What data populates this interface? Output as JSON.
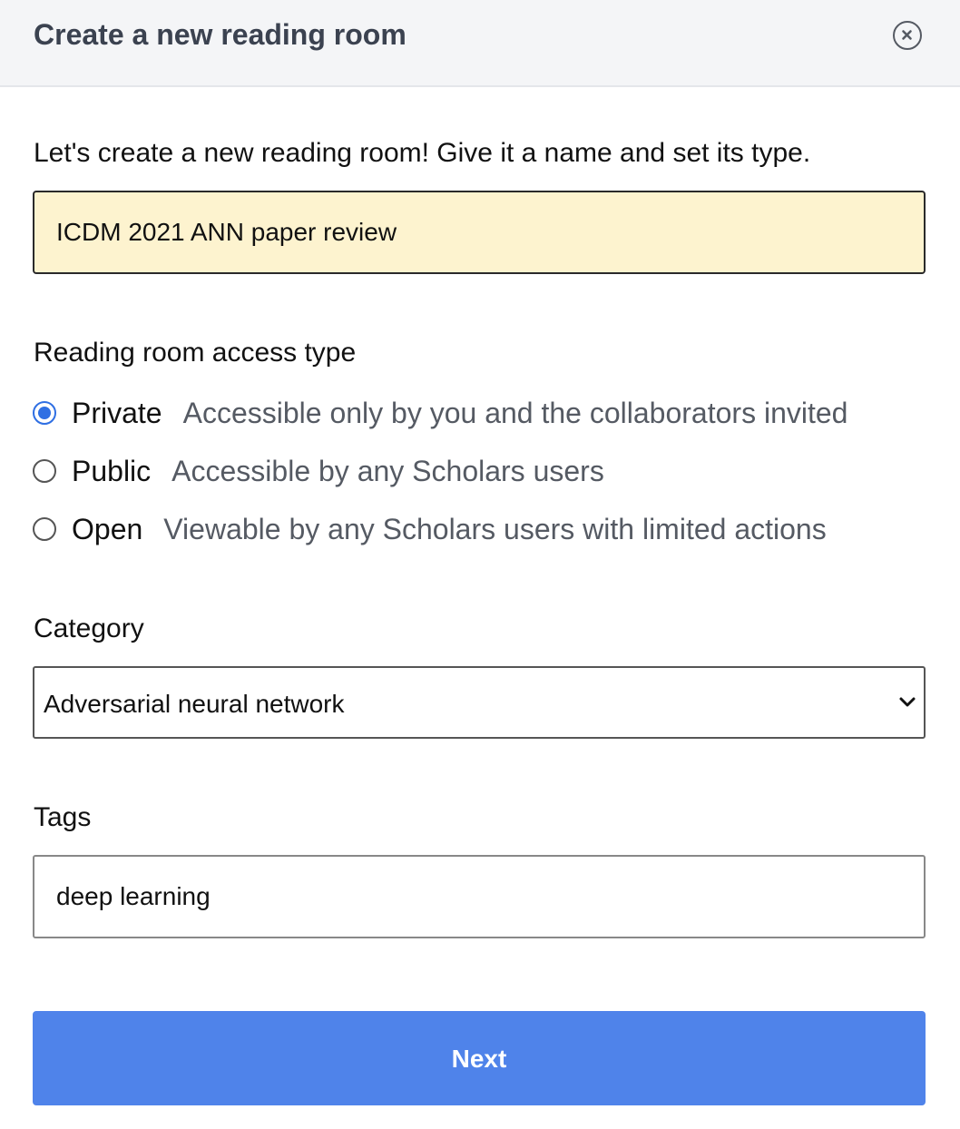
{
  "dialog": {
    "title": "Create a new reading room",
    "close_icon": "close-circle-icon"
  },
  "intro_text": "Let's create a new reading room! Give it a name and set its type.",
  "name_field": {
    "value": "ICDM 2021 ANN paper review",
    "background_color": "#fdf3cf"
  },
  "access": {
    "label": "Reading room access type",
    "selected": "Private",
    "options": [
      {
        "label": "Private",
        "description": "Accessible only by you and the collaborators invited",
        "checked": true
      },
      {
        "label": "Public",
        "description": "Accessible by any Scholars users",
        "checked": false
      },
      {
        "label": "Open",
        "description": "Viewable by any Scholars users with limited actions",
        "checked": false
      }
    ]
  },
  "category": {
    "label": "Category",
    "selected": "Adversarial neural network",
    "chevron_icon": "chevron-down-icon"
  },
  "tags": {
    "label": "Tags",
    "value": "deep learning"
  },
  "next_button": {
    "label": "Next",
    "color": "#4f83ea"
  },
  "colors": {
    "accent": "#2f6fe3",
    "header_bg": "#f4f5f7"
  }
}
